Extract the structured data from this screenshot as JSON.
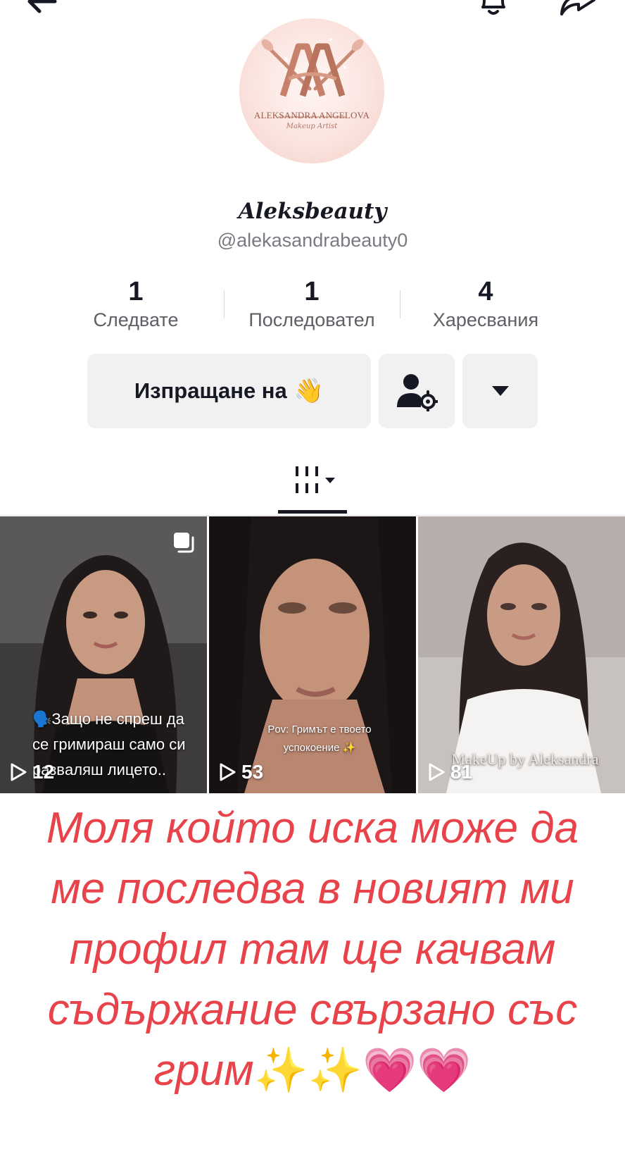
{
  "profile": {
    "avatar_brand": "ALEKSANDRA ANGELOVA",
    "avatar_tagline": "Makeup Artist",
    "display_name": "Aleksbeauty",
    "username": "@alekasandrabeauty0"
  },
  "stats": [
    {
      "value": "1",
      "label": "Следвате"
    },
    {
      "value": "1",
      "label": "Последовател"
    },
    {
      "value": "4",
      "label": "Харесвания"
    }
  ],
  "actions": {
    "message_label": "Изпращане на",
    "message_emoji": "👋"
  },
  "icons": {
    "back": "arrow-left-icon",
    "bell": "bell-icon",
    "share": "share-icon",
    "add_friend_settings": "user-settings-icon",
    "dropdown": "caret-down-icon",
    "grid_tab": "grid-tab-icon",
    "play": "play-icon",
    "multi_photo": "multi-photo-icon"
  },
  "videos": [
    {
      "caption": "🗣️Защо не спреш да се гримираш само си развaляш лицето..",
      "views": "12"
    },
    {
      "caption": "Pov: Гримът е твоето успокоение ✨",
      "views": "53"
    },
    {
      "caption": "MakeUp by Aleksandra",
      "views": "81"
    }
  ],
  "story_text": "Моля който иска може да ме последва в новият ми профил там ще качвам съдържание свързано със грим",
  "story_emojis": "✨✨💗💗",
  "colors": {
    "story_text": "#e8434a",
    "button_bg": "#f1f1f2",
    "primary_text": "#161823",
    "secondary_text": "#7a7b82"
  }
}
